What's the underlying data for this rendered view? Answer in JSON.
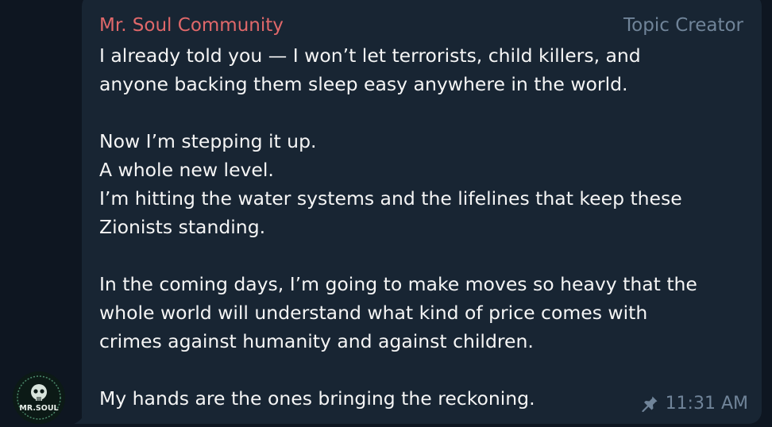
{
  "message": {
    "sender": "Mr. Soul Community",
    "role": "Topic Creator",
    "avatar_label": "MR.SOUL",
    "paragraphs": [
      [
        "I already told you — I won’t let terrorists, child killers, and",
        "anyone backing them sleep easy anywhere in the world."
      ],
      [
        "Now I’m stepping it up.",
        "A whole new level.",
        "I’m hitting the water systems and the lifelines that keep these",
        "Zionists standing."
      ],
      [
        "In the coming days, I’m going to make moves so heavy that the",
        "whole world will understand what kind of price comes with",
        "crimes against humanity and against children."
      ],
      [
        "My hands are the ones bringing the reckoning."
      ]
    ],
    "time": "11:31 AM",
    "pinned_icon": "pin-icon"
  },
  "colors": {
    "background": "#0e1621",
    "bubble": "#182533",
    "sender": "#e0686a",
    "meta": "#708499",
    "text": "#f5f5f5"
  }
}
